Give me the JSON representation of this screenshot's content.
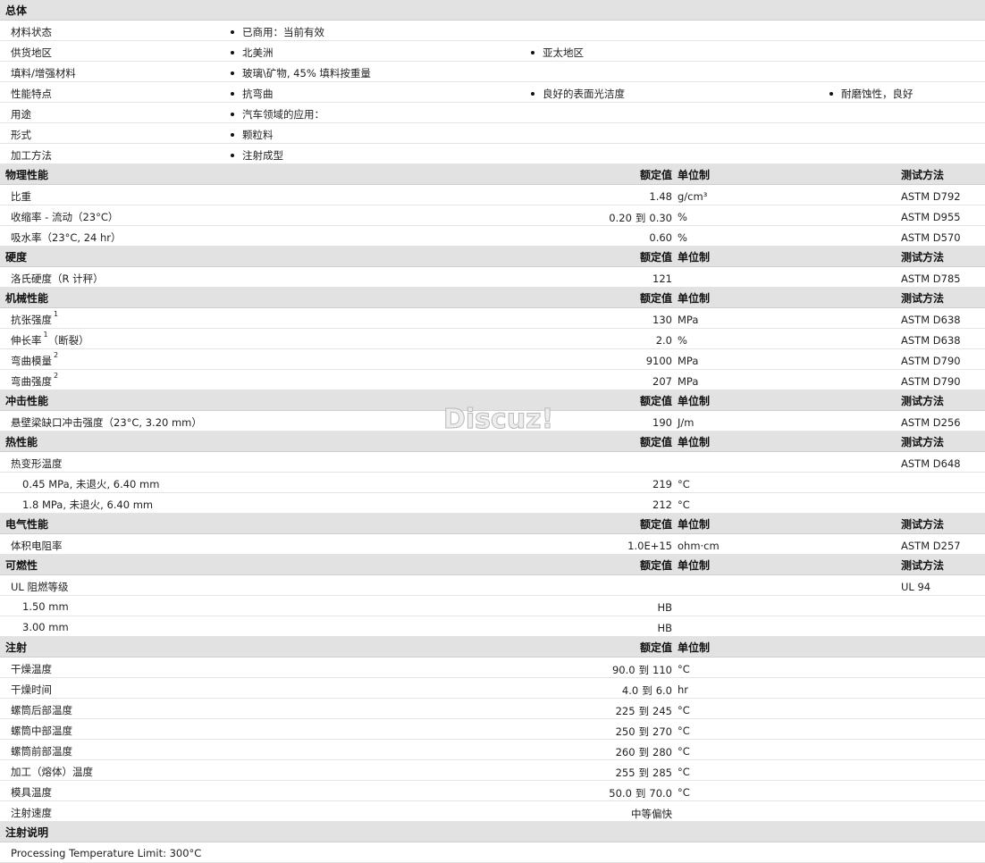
{
  "general": {
    "title": "总体",
    "rows": [
      {
        "label": "材料状态",
        "bullets": [
          "已商用：当前有效"
        ]
      },
      {
        "label": "供货地区",
        "bullets": [
          "北美洲",
          "亚太地区"
        ]
      },
      {
        "label": "填料/增强材料",
        "bullets": [
          "玻璃\\矿物, 45% 填料按重量"
        ]
      },
      {
        "label": "性能特点",
        "bullets": [
          "抗弯曲",
          "良好的表面光洁度",
          "耐磨蚀性，良好"
        ]
      },
      {
        "label": "用途",
        "bullets": [
          "汽车领域的应用："
        ]
      },
      {
        "label": "形式",
        "bullets": [
          "颗粒料"
        ]
      },
      {
        "label": "加工方法",
        "bullets": [
          "注射成型"
        ]
      }
    ]
  },
  "headers": {
    "value": "额定值",
    "unit": "单位制",
    "test": "测试方法"
  },
  "sections": [
    {
      "title": "物理性能",
      "headers": true,
      "rows": [
        {
          "label": "比重",
          "v1": "1.48",
          "v2": "",
          "unit": "g/cm³",
          "test": "ASTM D792"
        },
        {
          "label": "收缩率 - 流动（23°C）",
          "v1": "0.20",
          "v2": "0.30",
          "unit": "%",
          "test": "ASTM D955"
        },
        {
          "label": "吸水率（23°C, 24 hr）",
          "v1": "0.60",
          "v2": "",
          "unit": "%",
          "test": "ASTM D570"
        }
      ]
    },
    {
      "title": "硬度",
      "headers": true,
      "rows": [
        {
          "label": "洛氏硬度（R 计秤）",
          "v1": "121",
          "v2": "",
          "unit": "",
          "test": "ASTM D785"
        }
      ]
    },
    {
      "title": "机械性能",
      "headers": true,
      "rows": [
        {
          "label": "抗张强度",
          "sup": "1",
          "v1": "130",
          "v2": "",
          "unit": "MPa",
          "test": "ASTM D638"
        },
        {
          "label": "伸长率",
          "sup": "1",
          "suffix": "（断裂）",
          "v1": "2.0",
          "v2": "",
          "unit": "%",
          "test": "ASTM D638"
        },
        {
          "label": "弯曲模量",
          "sup": "2",
          "v1": "9100",
          "v2": "",
          "unit": "MPa",
          "test": "ASTM D790"
        },
        {
          "label": "弯曲强度",
          "sup": "2",
          "v1": "207",
          "v2": "",
          "unit": "MPa",
          "test": "ASTM D790"
        }
      ]
    },
    {
      "title": "冲击性能",
      "headers": true,
      "rows": [
        {
          "label": "悬壁梁缺口冲击强度（23°C, 3.20 mm）",
          "v1": "190",
          "v2": "",
          "unit": "J/m",
          "test": "ASTM D256"
        }
      ]
    },
    {
      "title": "热性能",
      "headers": true,
      "rows": [
        {
          "label": "热变形温度",
          "v1": "",
          "v2": "",
          "unit": "",
          "test": "ASTM D648"
        },
        {
          "label": "0.45 MPa, 未退火, 6.40 mm",
          "sub": true,
          "v1": "219",
          "v2": "",
          "unit": "°C",
          "test": ""
        },
        {
          "label": "1.8 MPa, 未退火, 6.40 mm",
          "sub": true,
          "v1": "212",
          "v2": "",
          "unit": "°C",
          "test": ""
        }
      ]
    },
    {
      "title": "电气性能",
      "headers": true,
      "rows": [
        {
          "label": "体积电阻率",
          "v1": "1.0E+15",
          "v2": "",
          "unit": "ohm·cm",
          "test": "ASTM D257"
        }
      ]
    },
    {
      "title": "可燃性",
      "headers": true,
      "rows": [
        {
          "label": "UL 阻燃等级",
          "v1": "",
          "v2": "",
          "unit": "",
          "test": "UL 94"
        },
        {
          "label": "1.50 mm",
          "sub": true,
          "v1": "HB",
          "v2": "",
          "unit": "",
          "test": ""
        },
        {
          "label": "3.00 mm",
          "sub": true,
          "v1": "HB",
          "v2": "",
          "unit": "",
          "test": ""
        }
      ]
    },
    {
      "title": "注射",
      "headers": "partial",
      "rows": [
        {
          "label": "干燥温度",
          "v1": "90.0",
          "v2": "110",
          "unit": "°C",
          "test": ""
        },
        {
          "label": "干燥时间",
          "v1": "4.0",
          "v2": "6.0",
          "unit": "hr",
          "test": ""
        },
        {
          "label": "螺筒后部温度",
          "v1": "225",
          "v2": "245",
          "unit": "°C",
          "test": ""
        },
        {
          "label": "螺筒中部温度",
          "v1": "250",
          "v2": "270",
          "unit": "°C",
          "test": ""
        },
        {
          "label": "螺筒前部温度",
          "v1": "260",
          "v2": "280",
          "unit": "°C",
          "test": ""
        },
        {
          "label": "加工（熔体）温度",
          "v1": "255",
          "v2": "285",
          "unit": "°C",
          "test": ""
        },
        {
          "label": "模具温度",
          "v1": "50.0",
          "v2": "70.0",
          "unit": "°C",
          "test": ""
        },
        {
          "label": "注射速度",
          "v1": "中等偏快",
          "v2": "",
          "unit": "",
          "test": ""
        }
      ]
    },
    {
      "title": "注射说明",
      "headers": false,
      "rows": [
        {
          "label": "Processing Temperature Limit: 300°C",
          "note": true
        }
      ]
    }
  ],
  "range_word": "到",
  "watermark": "Discuz!"
}
